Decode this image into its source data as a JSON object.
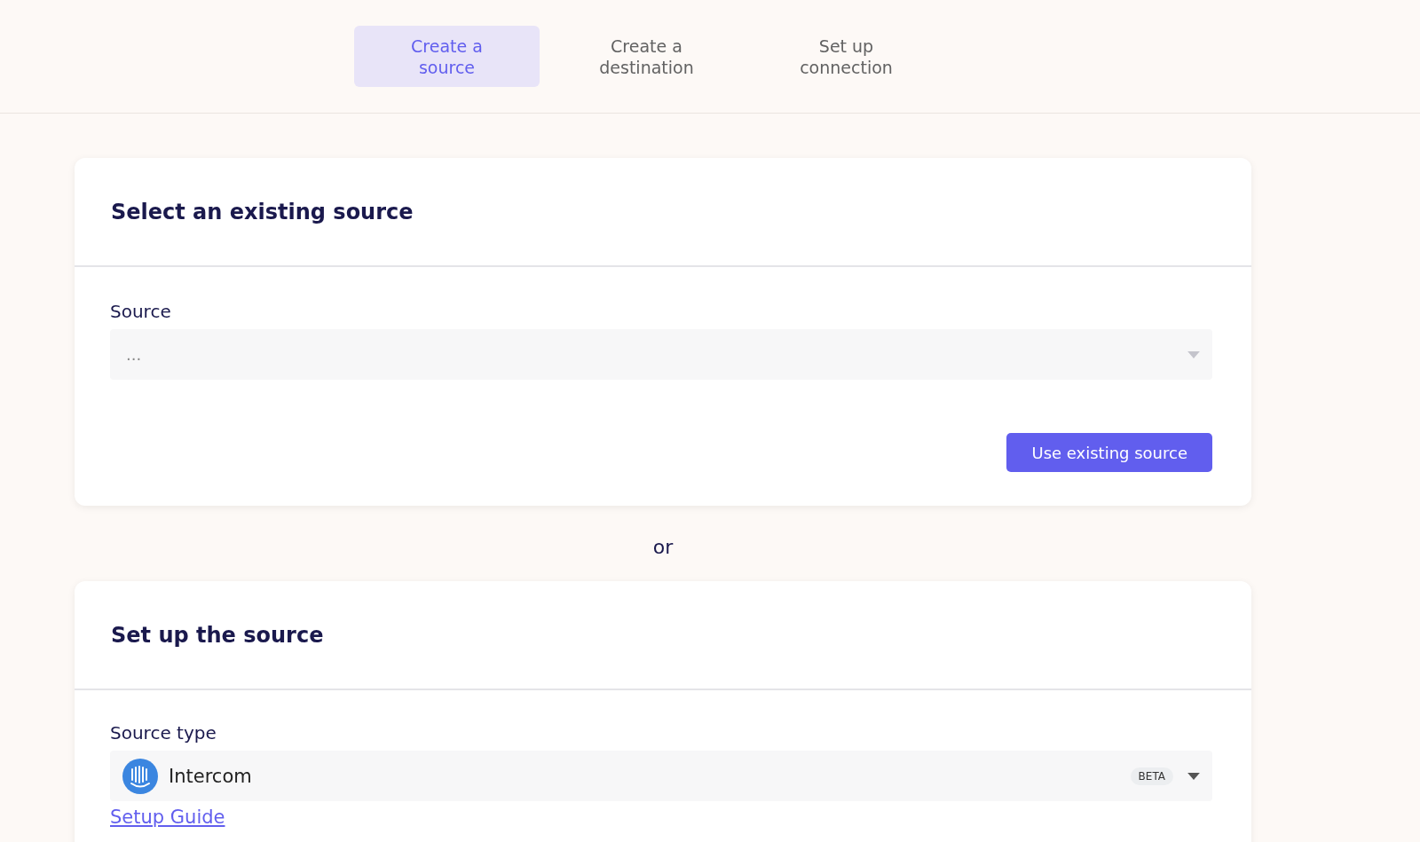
{
  "steps": [
    {
      "label": "Create a source",
      "selected": true
    },
    {
      "label": "Create a destination",
      "selected": false
    },
    {
      "label": "Set up connection",
      "selected": false
    }
  ],
  "existing_source": {
    "title": "Select an existing source",
    "field_label": "Source",
    "placeholder": "...",
    "button": "Use existing source"
  },
  "separator": "or",
  "new_source": {
    "title": "Set up the source",
    "field_label": "Source type",
    "value": "Intercom",
    "badge": "BETA",
    "link": "Setup Guide"
  }
}
